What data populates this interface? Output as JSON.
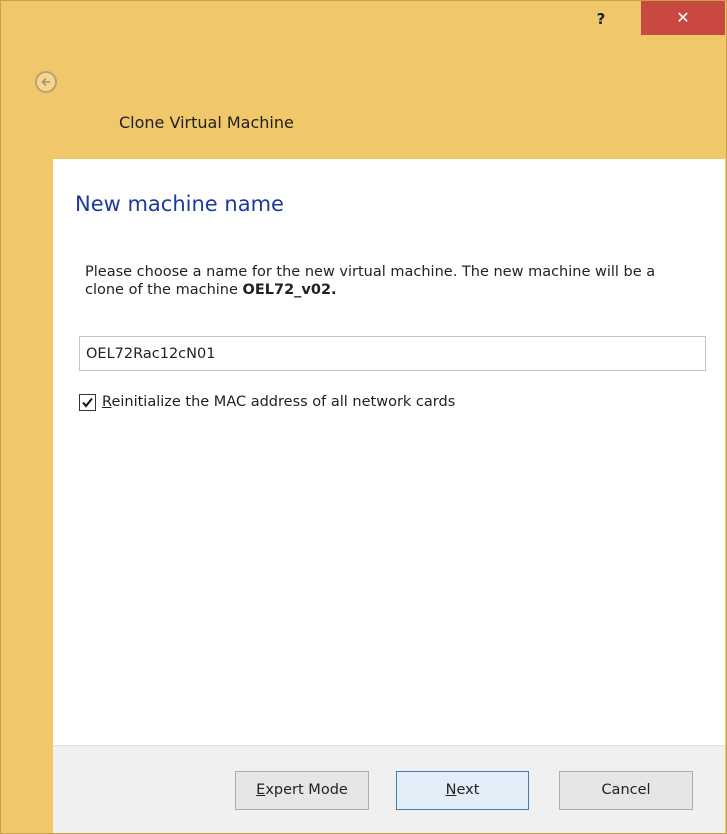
{
  "titlebar": {
    "help_label": "?",
    "close_label": "✕"
  },
  "header": {
    "title": "Clone Virtual Machine",
    "back_icon": "back-arrow-icon"
  },
  "page": {
    "title": "New machine name",
    "description_prefix": "Please choose a name for the new virtual machine. The new machine will be a clone of the machine ",
    "source_machine": "OEL72_v02",
    "description_suffix": "."
  },
  "form": {
    "name_value": "OEL72Rac12cN01",
    "reinit_mac_checked": true,
    "reinit_mac_label_first": "R",
    "reinit_mac_label_rest": "einitialize the MAC address of all network cards"
  },
  "footer": {
    "expert_first": "E",
    "expert_rest": "xpert Mode",
    "next_first": "N",
    "next_rest": "ext",
    "cancel_label": "Cancel"
  },
  "colors": {
    "titlebar_bg": "#f0c86a",
    "close_bg": "#c9483f",
    "title_blue": "#1c3a9a"
  }
}
